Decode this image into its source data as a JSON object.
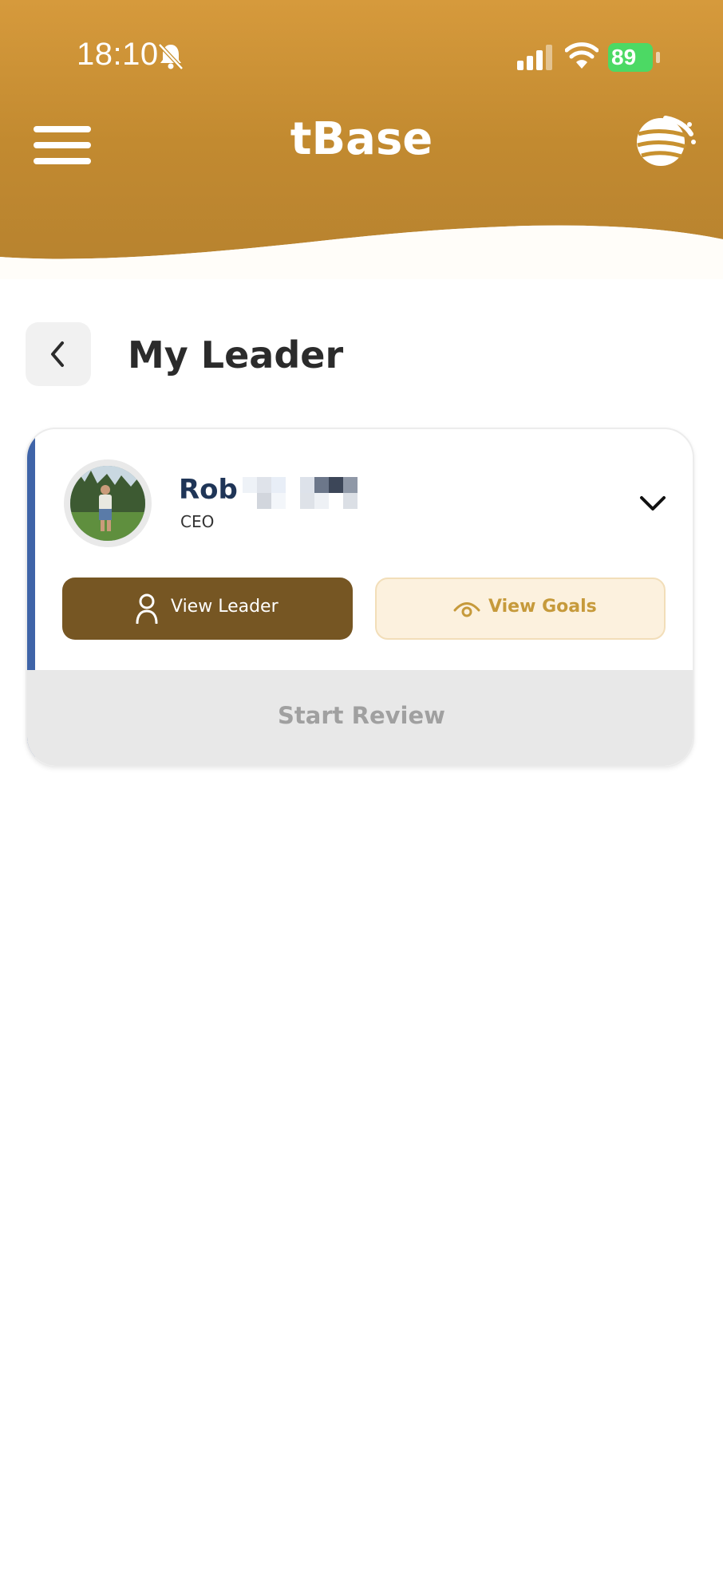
{
  "status_bar": {
    "time": "18:10",
    "battery": "89",
    "icons": [
      "bell-slash-icon",
      "signal-icon",
      "wifi-icon",
      "battery-icon"
    ]
  },
  "header": {
    "app_title": "tBase",
    "menu_icon": "hamburger-icon",
    "logo_icon": "globe-logo-icon"
  },
  "page": {
    "title": "My Leader",
    "back_icon": "chevron-left-icon"
  },
  "leader_card": {
    "name": "Rob",
    "role": "CEO",
    "expand_icon": "chevron-down-icon",
    "view_leader_label": "View Leader",
    "view_goals_label": "View Goals",
    "start_review_label": "Start Review"
  },
  "colors": {
    "header_gold": "#c8912f",
    "accent_blue": "#3f64a8",
    "primary_brown": "#765623",
    "goals_bg": "#fcf1de",
    "goals_text": "#c69a3b",
    "disabled_bg": "#e8e8e8",
    "disabled_text": "#a0a0a0"
  }
}
